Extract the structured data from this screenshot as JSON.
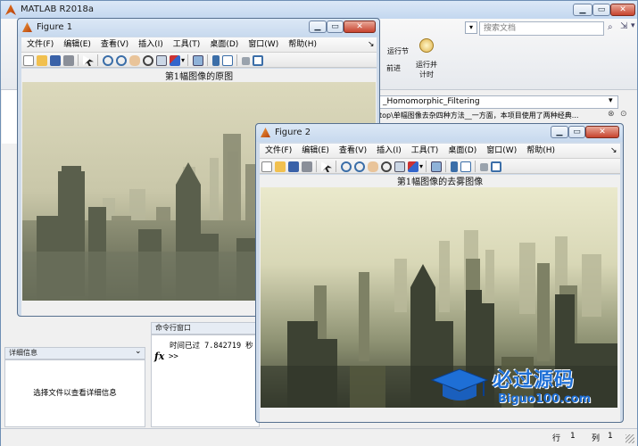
{
  "main": {
    "title": "MATLAB R2018a",
    "search_placeholder": "搜索文档",
    "toolstrip": {
      "run_section": "运行节",
      "advance": "前进",
      "run_and_time": "运行并\n计时"
    },
    "editor_path": "_Homomorphic_Filtering",
    "editor_desc": "top\\单幅图像去杂四种方法__一方面，本项目使用了两种经典...",
    "details_panel": {
      "header": "详细信息",
      "message": "选择文件以查看详细信息"
    },
    "command_window": {
      "header": "命令行窗口",
      "output": "时间已过 7.842719 秒",
      "fx": "fx",
      "prompt": ">>"
    },
    "status": {
      "row_label": "行",
      "row_value": "1",
      "col_label": "列",
      "col_value": "1"
    }
  },
  "figure1": {
    "title": "Figure 1",
    "menus": [
      "文件(F)",
      "编辑(E)",
      "查看(V)",
      "插入(I)",
      "工具(T)",
      "桌面(D)",
      "窗口(W)",
      "帮助(H)"
    ],
    "axes_title": "第1幅图像的原图"
  },
  "figure2": {
    "title": "Figure 2",
    "menus": [
      "文件(F)",
      "编辑(E)",
      "查看(V)",
      "插入(I)",
      "工具(T)",
      "桌面(D)",
      "窗口(W)",
      "帮助(H)"
    ],
    "axes_title": "第1幅图像的去雾图像"
  },
  "watermark": {
    "title": "必过源码",
    "url": "Biguo100.com"
  },
  "colors": {
    "titlebar": "#c3d7ef",
    "close_button": "#c7432e",
    "haze": "#d6d3b4",
    "dehazed_sky": "#e6e5c8",
    "watermark_blue": "#1e6fd6"
  }
}
